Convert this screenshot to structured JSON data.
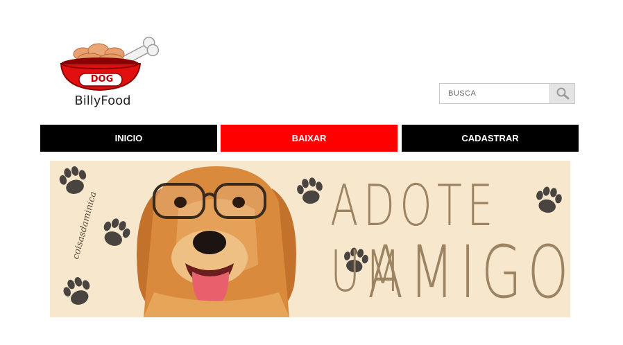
{
  "logo": {
    "badge_text": "DOG",
    "brand_name": "BillyFood"
  },
  "search": {
    "placeholder": "BUSCA",
    "icon": "magnifier-icon"
  },
  "nav": {
    "items": [
      {
        "label": "INICIO",
        "active": false
      },
      {
        "label": "BAIXAR",
        "active": true
      },
      {
        "label": "CADASTRAR",
        "active": false
      }
    ],
    "active_color": "#ff0000",
    "default_color": "#000000"
  },
  "banner": {
    "line1": "ADOTE UM",
    "line2": "AMIGO",
    "watermark": "coisasdaminica",
    "background": "#f6e7cd",
    "text_color": "#9c8463"
  }
}
